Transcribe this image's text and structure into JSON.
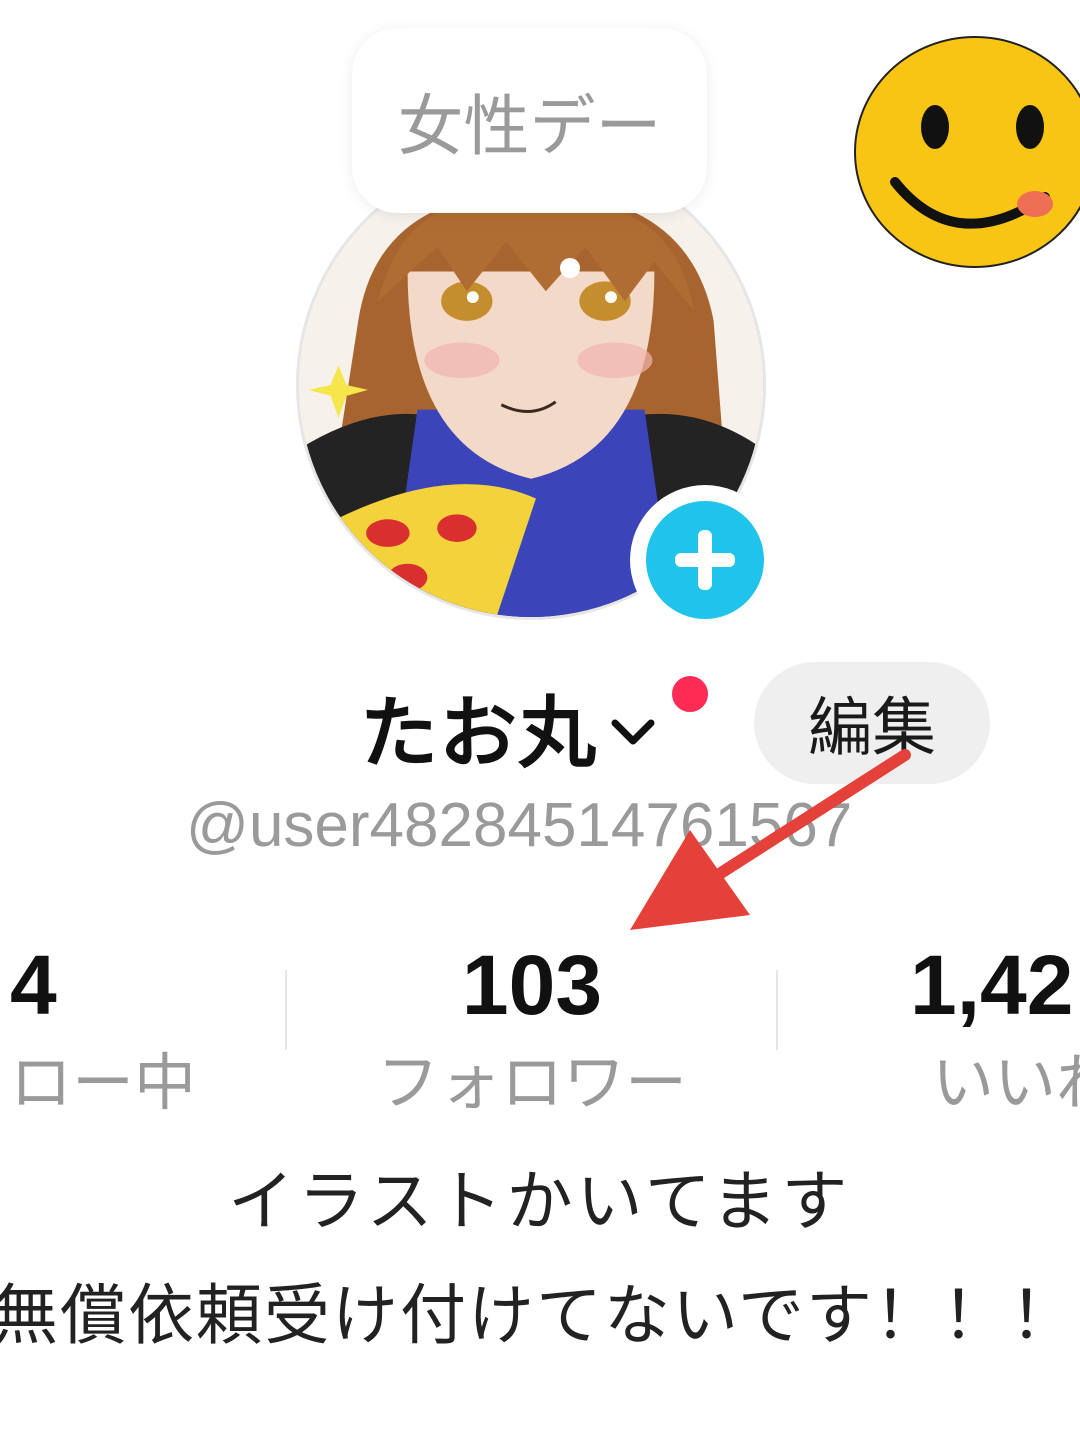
{
  "status_bubble": {
    "text": "女性デー"
  },
  "profile": {
    "display_name": "たお丸",
    "username": "@user48284514761567",
    "edit_label": "編集"
  },
  "stats": {
    "following": {
      "value": "4",
      "label": "ロー中"
    },
    "followers": {
      "value": "103",
      "label": "フォロワー"
    },
    "likes": {
      "value": "1,42",
      "label": "いいね"
    }
  },
  "bio": {
    "line1": "イラストかいてます",
    "line2": "無償依頼受け付けてないです！！！"
  },
  "icons": {
    "emoji": "smiley-face-tongue-icon",
    "add": "plus-icon",
    "chevron": "chevron-down-icon"
  },
  "colors": {
    "accent_blue": "#20c4ea",
    "notification_red": "#fe2c55",
    "annotation_red": "#e5413b",
    "emoji_yellow": "#f8c515"
  }
}
